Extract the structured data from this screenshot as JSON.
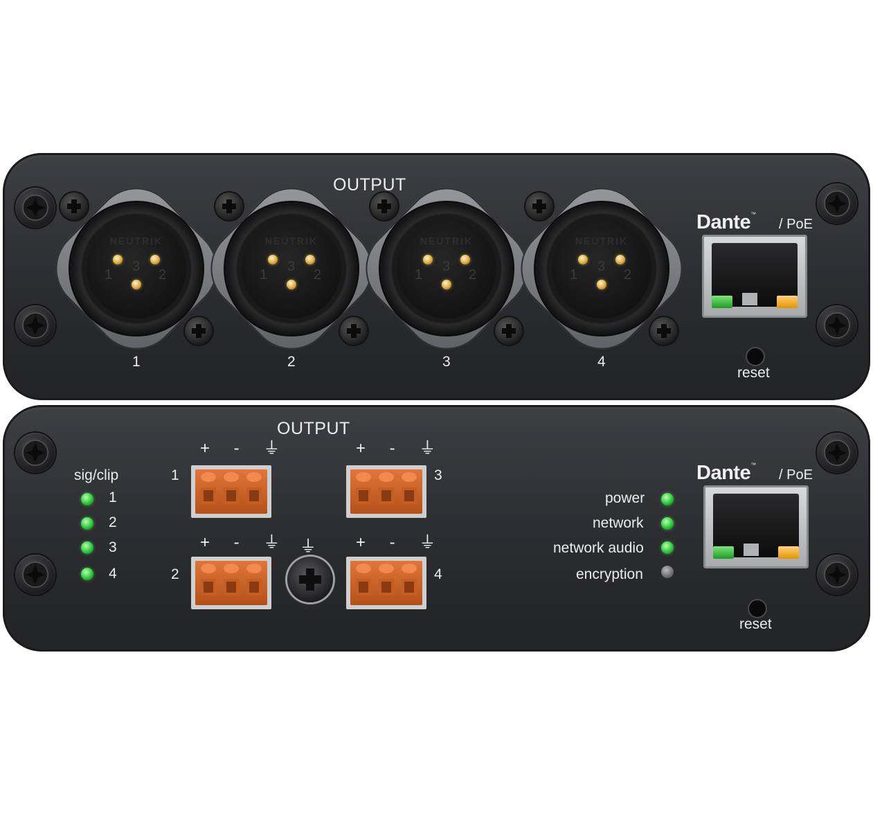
{
  "top_panel": {
    "title": "OUTPUT",
    "connectors": [
      {
        "number": "1",
        "brand": "NEUTRIK",
        "pins": [
          "1",
          "3",
          "2"
        ]
      },
      {
        "number": "2",
        "brand": "NEUTRIK",
        "pins": [
          "1",
          "3",
          "2"
        ]
      },
      {
        "number": "3",
        "brand": "NEUTRIK",
        "pins": [
          "1",
          "3",
          "2"
        ]
      },
      {
        "number": "4",
        "brand": "NEUTRIK",
        "pins": [
          "1",
          "3",
          "2"
        ]
      }
    ],
    "dante_logo": "Dante",
    "dante_tm": "™",
    "poe_label": "/ PoE",
    "reset_label": "reset"
  },
  "bottom_panel": {
    "title": "OUTPUT",
    "sig_clip_label": "sig/clip",
    "channel_leds": [
      "1",
      "2",
      "3",
      "4"
    ],
    "terminal_blocks": [
      "1",
      "3",
      "2",
      "4"
    ],
    "pin_symbols": "+ - ⏚",
    "ground_symbol": "⏚",
    "status_leds": [
      {
        "label": "power",
        "state": "on"
      },
      {
        "label": "network",
        "state": "on"
      },
      {
        "label": "network audio",
        "state": "on"
      },
      {
        "label": "encryption",
        "state": "off"
      }
    ],
    "dante_logo": "Dante",
    "dante_tm": "™",
    "poe_label": "/ PoE",
    "reset_label": "reset"
  },
  "colors": {
    "panel": "#2f3033",
    "led_green": "#2ec83a",
    "led_off": "#6d6d6f",
    "terminal_orange": "#d2622a",
    "link_amber": "#e59300"
  }
}
